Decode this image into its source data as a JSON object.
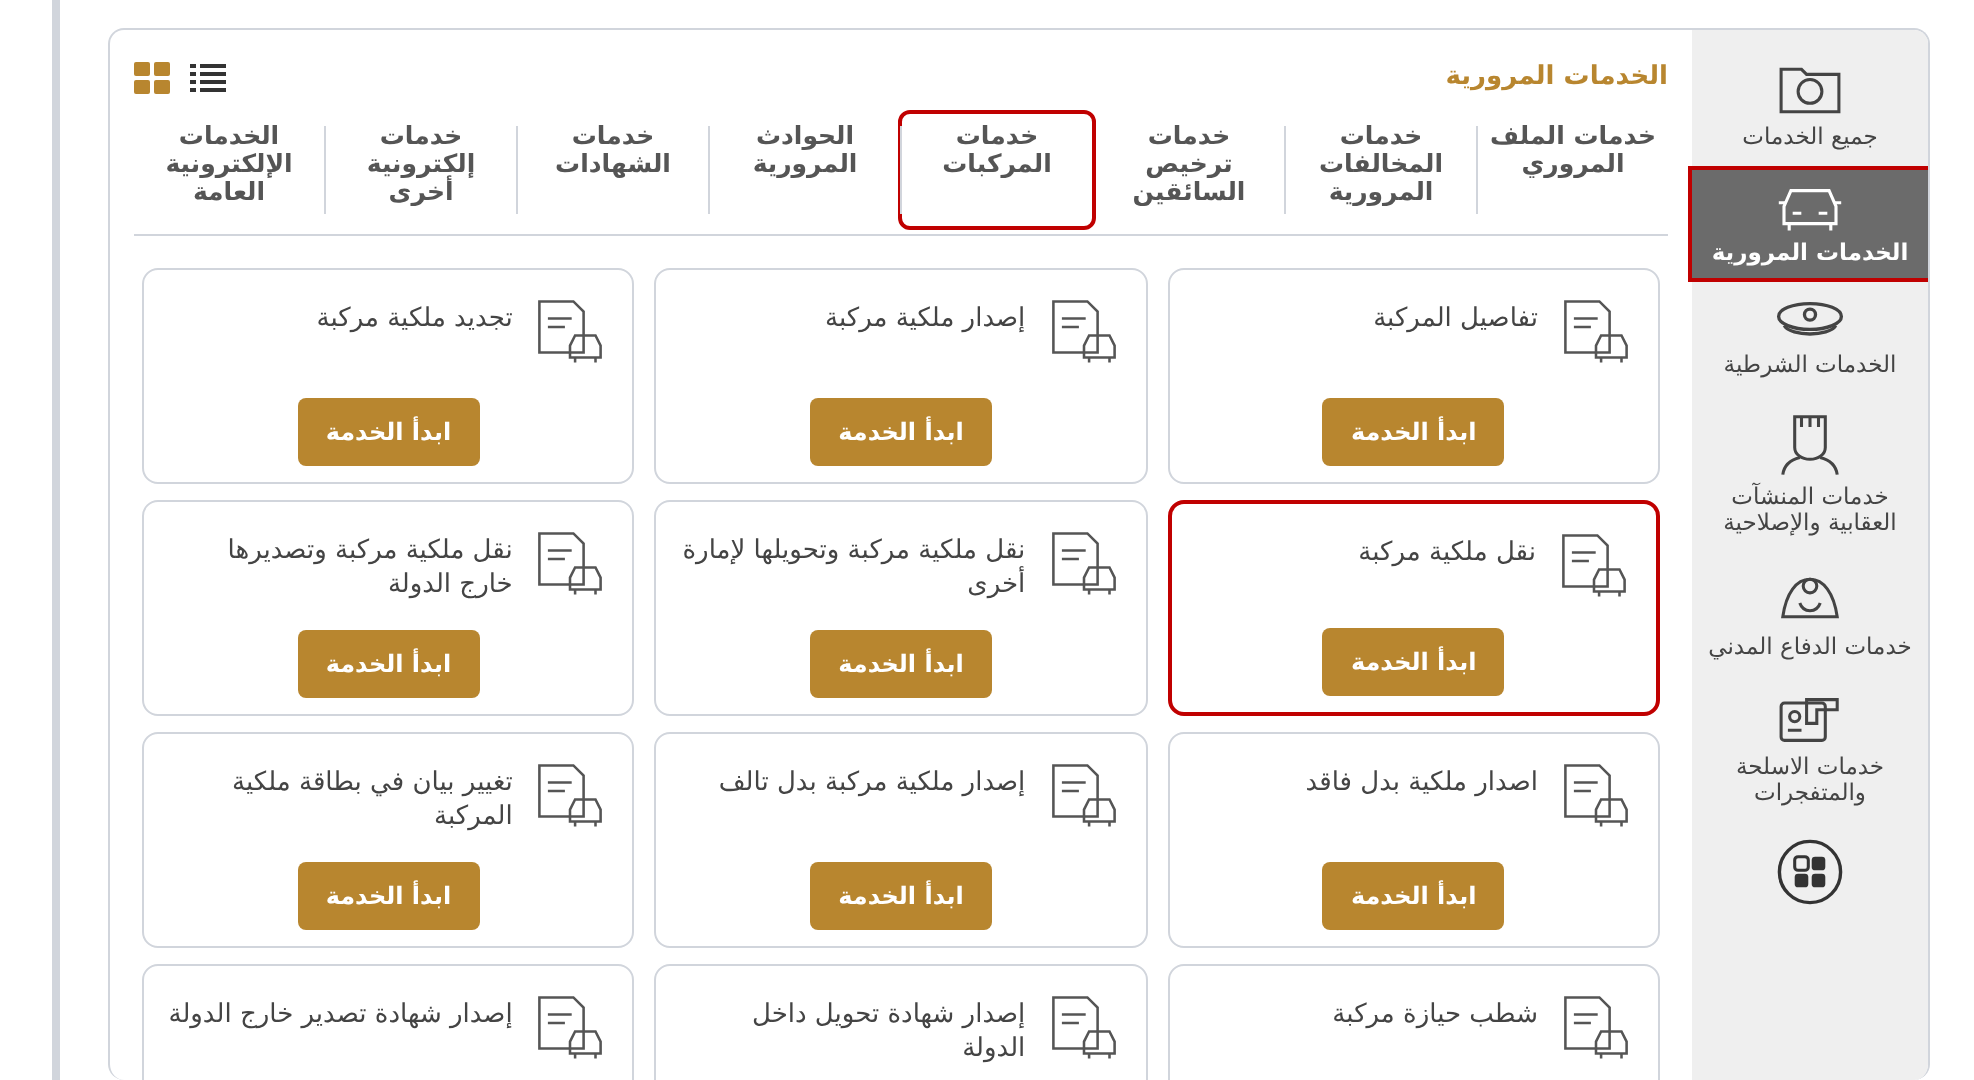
{
  "sidebar": {
    "items": [
      {
        "label": "جميع الخدمات",
        "kind": "folder",
        "selected": false,
        "highlighted": false
      },
      {
        "label": "الخدمات المرورية",
        "kind": "car",
        "selected": true,
        "highlighted": true
      },
      {
        "label": "الخدمات الشرطية",
        "kind": "cap",
        "selected": false,
        "highlighted": false
      },
      {
        "label": "خدمات المنشآت العقابية والإصلاحية",
        "kind": "prisoner",
        "selected": false,
        "highlighted": false
      },
      {
        "label": "خدمات الدفاع المدني",
        "kind": "helmet",
        "selected": false,
        "highlighted": false
      },
      {
        "label": "خدمات الاسلحة والمتفجرات",
        "kind": "card",
        "selected": false,
        "highlighted": false
      },
      {
        "kind": "grid",
        "selected": false,
        "highlighted": false
      }
    ]
  },
  "header": {
    "title": "الخدمات المرورية"
  },
  "view_toggle": [
    {
      "kind": "grid",
      "selected": true
    },
    {
      "kind": "list",
      "selected": false
    }
  ],
  "tabs": [
    {
      "label": "خدمات الملف المروري",
      "highlighted": false
    },
    {
      "label": "خدمات المخالفات المرورية",
      "highlighted": false
    },
    {
      "label": "خدمات ترخيص السائقين",
      "highlighted": false
    },
    {
      "label": "خدمات المركبات",
      "highlighted": true
    },
    {
      "label": "الحوادث المرورية",
      "highlighted": false
    },
    {
      "label": "خدمات الشهادات",
      "highlighted": false
    },
    {
      "label": "خدمات إلكترونية أخرى",
      "highlighted": false
    },
    {
      "label": "الخدمات الإلكترونية العامة",
      "highlighted": false
    }
  ],
  "cards": [
    {
      "title": "تفاصيل المركبة",
      "button": "ابدأ الخدمة",
      "highlighted": false
    },
    {
      "title": "إصدار ملكية مركبة",
      "button": "ابدأ الخدمة",
      "highlighted": false
    },
    {
      "title": "تجديد ملكية مركبة",
      "button": "ابدأ الخدمة",
      "highlighted": false
    },
    {
      "title": "نقل ملكية مركبة",
      "button": "ابدأ الخدمة",
      "highlighted": true
    },
    {
      "title": "نقل ملكية مركبة وتحويلها لإمارة أخرى",
      "button": "ابدأ الخدمة",
      "highlighted": false
    },
    {
      "title": "نقل ملكية مركبة وتصديرها خارج الدولة",
      "button": "ابدأ الخدمة",
      "highlighted": false
    },
    {
      "title": "اصدار ملكية بدل فاقد",
      "button": "ابدأ الخدمة",
      "highlighted": false
    },
    {
      "title": "إصدار ملكية مركبة بدل تالف",
      "button": "ابدأ الخدمة",
      "highlighted": false
    },
    {
      "title": "تغيير بيان في بطاقة ملكية المركبة",
      "button": "ابدأ الخدمة",
      "highlighted": false
    },
    {
      "title": "شطب حيازة مركبة",
      "highlighted": false
    },
    {
      "title": "إصدار شهادة تحويل داخل الدولة",
      "highlighted": false
    },
    {
      "title": "إصدار شهادة تصدير خارج الدولة",
      "highlighted": false
    }
  ]
}
